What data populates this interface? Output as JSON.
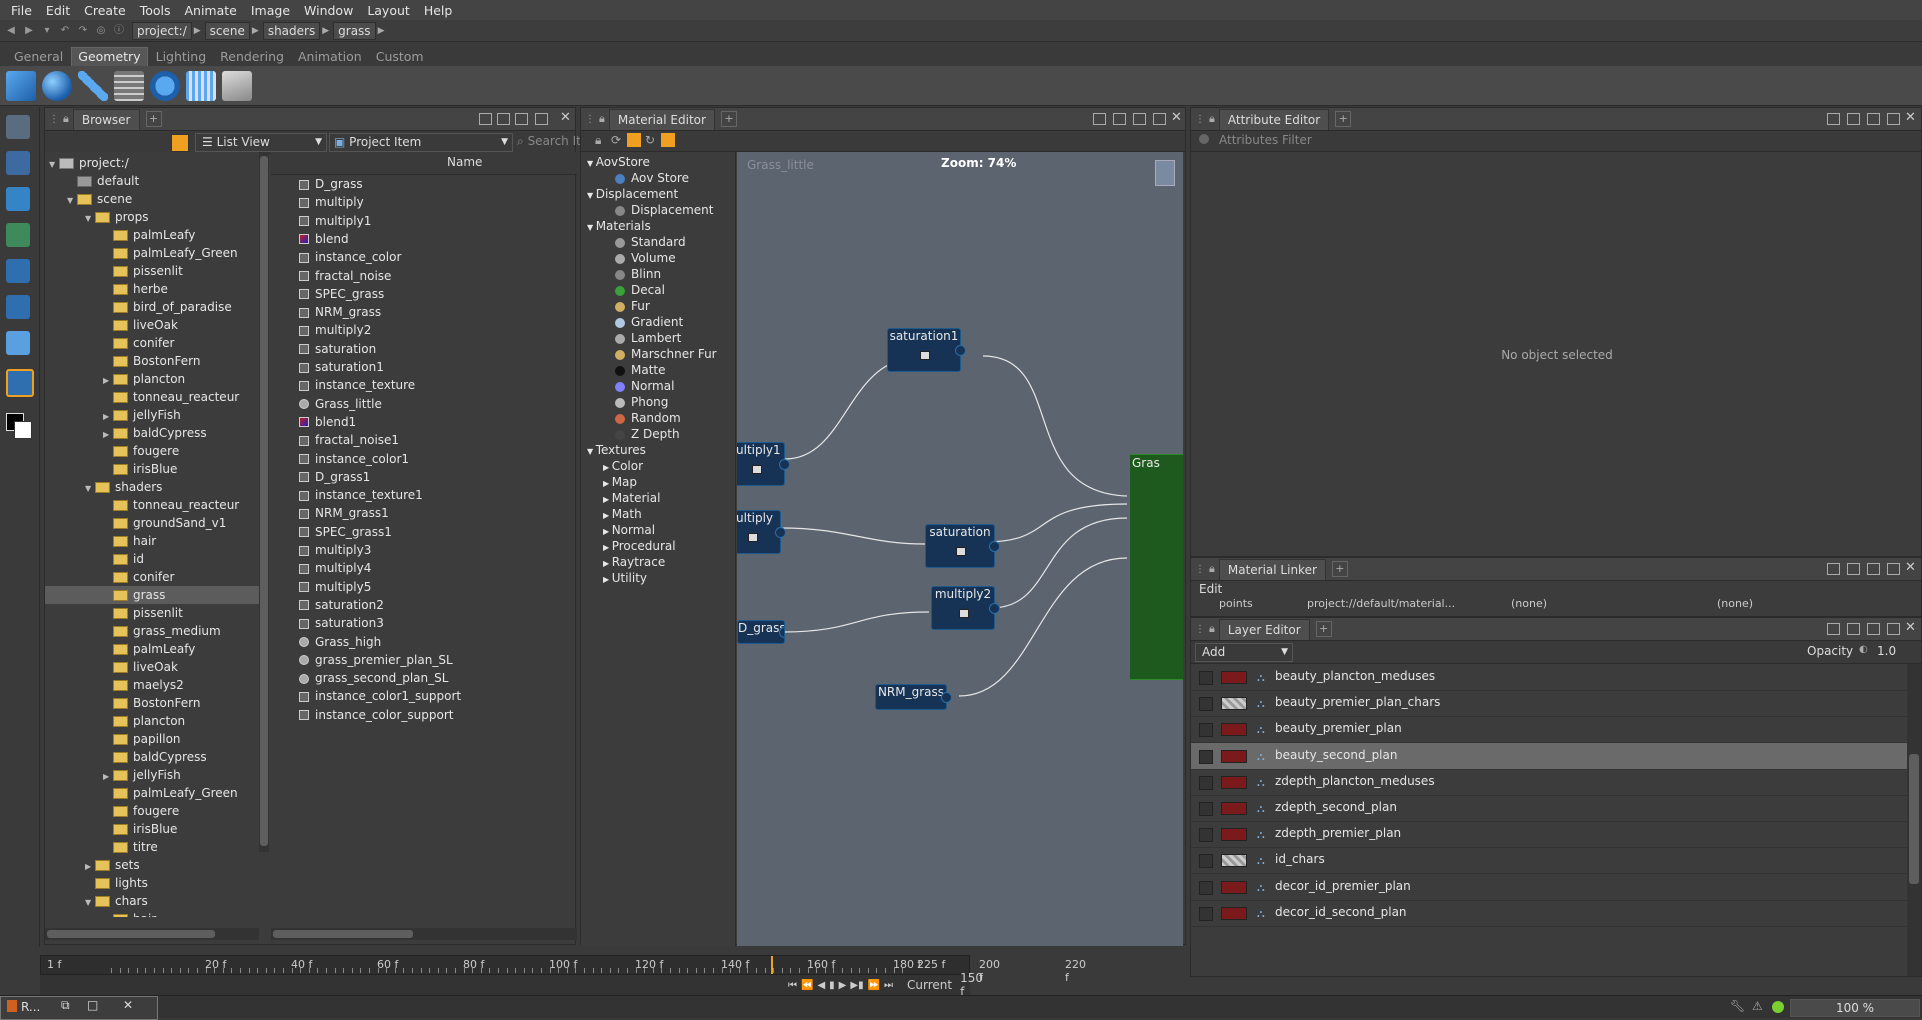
{
  "menu": [
    "File",
    "Edit",
    "Create",
    "Tools",
    "Animate",
    "Image",
    "Window",
    "Layout",
    "Help"
  ],
  "breadcrumbs": [
    "project:/",
    "scene",
    "shaders",
    "grass"
  ],
  "shelf_tabs": [
    {
      "label": "General",
      "active": false
    },
    {
      "label": "Geometry",
      "active": true
    },
    {
      "label": "Lighting",
      "active": false
    },
    {
      "label": "Rendering",
      "active": false
    },
    {
      "label": "Animation",
      "active": false
    },
    {
      "label": "Custom",
      "active": false
    }
  ],
  "shelf_icons": [
    "cube-icon",
    "sphere-icon",
    "cylinder-icon",
    "plane-icon",
    "disc-icon",
    "grid-icon",
    "scroll-icon"
  ],
  "browser": {
    "tab": "Browser",
    "view_mode": "List View",
    "filter": "Project Item",
    "search_placeholder": "Search Items",
    "column_name": "Name",
    "tree": [
      {
        "label": "project:/",
        "depth": 0,
        "expanded": true
      },
      {
        "label": "default",
        "depth": 1,
        "expanded": false
      },
      {
        "label": "scene",
        "depth": 1,
        "expanded": true
      },
      {
        "label": "props",
        "depth": 2,
        "expanded": true
      },
      {
        "label": "palmLeafy",
        "depth": 3
      },
      {
        "label": "palmLeafy_Green",
        "depth": 3
      },
      {
        "label": "pissenlit",
        "depth": 3
      },
      {
        "label": "herbe",
        "depth": 3
      },
      {
        "label": "bird_of_paradise",
        "depth": 3
      },
      {
        "label": "liveOak",
        "depth": 3
      },
      {
        "label": "conifer",
        "depth": 3
      },
      {
        "label": "BostonFern",
        "depth": 3
      },
      {
        "label": "plancton",
        "depth": 3,
        "collapsed": true
      },
      {
        "label": "tonneau_reacteur",
        "depth": 3
      },
      {
        "label": "jellyFish",
        "depth": 3,
        "collapsed": true
      },
      {
        "label": "baldCypress",
        "depth": 3,
        "collapsed": true
      },
      {
        "label": "fougere",
        "depth": 3
      },
      {
        "label": "irisBlue",
        "depth": 3
      },
      {
        "label": "shaders",
        "depth": 2,
        "expanded": true
      },
      {
        "label": "tonneau_reacteur",
        "depth": 3
      },
      {
        "label": "groundSand_v1",
        "depth": 3
      },
      {
        "label": "hair",
        "depth": 3
      },
      {
        "label": "id",
        "depth": 3
      },
      {
        "label": "conifer",
        "depth": 3
      },
      {
        "label": "grass",
        "depth": 3,
        "selected": true
      },
      {
        "label": "pissenlit",
        "depth": 3
      },
      {
        "label": "grass_medium",
        "depth": 3
      },
      {
        "label": "palmLeafy",
        "depth": 3
      },
      {
        "label": "liveOak",
        "depth": 3
      },
      {
        "label": "maelys2",
        "depth": 3
      },
      {
        "label": "BostonFern",
        "depth": 3
      },
      {
        "label": "plancton",
        "depth": 3
      },
      {
        "label": "papillon",
        "depth": 3
      },
      {
        "label": "baldCypress",
        "depth": 3
      },
      {
        "label": "jellyFish",
        "depth": 3,
        "collapsed": true
      },
      {
        "label": "palmLeafy_Green",
        "depth": 3
      },
      {
        "label": "fougere",
        "depth": 3
      },
      {
        "label": "irisBlue",
        "depth": 3
      },
      {
        "label": "titre",
        "depth": 3
      },
      {
        "label": "sets",
        "depth": 2,
        "collapsed": true
      },
      {
        "label": "lights",
        "depth": 2
      },
      {
        "label": "chars",
        "depth": 2,
        "expanded": true
      },
      {
        "label": "hair",
        "depth": 3
      }
    ],
    "items": [
      "D_grass",
      "multiply",
      "multiply1",
      "blend",
      "instance_color",
      "fractal_noise",
      "SPEC_grass",
      "NRM_grass",
      "multiply2",
      "saturation",
      "saturation1",
      "instance_texture",
      "Grass_little",
      "blend1",
      "fractal_noise1",
      "instance_color1",
      "D_grass1",
      "instance_texture1",
      "NRM_grass1",
      "SPEC_grass1",
      "multiply3",
      "multiply4",
      "multiply5",
      "saturation2",
      "saturation3",
      "Grass_high",
      "grass_premier_plan_SL",
      "grass_second_plan_SL",
      "instance_color1_support",
      "instance_color_support"
    ]
  },
  "material_editor": {
    "tab": "Material Editor",
    "graph_title": "Grass_little",
    "zoom": "Zoom: 74%",
    "library": [
      {
        "label": "AovStore",
        "type": "group"
      },
      {
        "label": "Aov Store",
        "type": "item",
        "color": "#4a7fc0"
      },
      {
        "label": "Displacement",
        "type": "group"
      },
      {
        "label": "Displacement",
        "type": "item",
        "color": "#888888"
      },
      {
        "label": "Materials",
        "type": "group"
      },
      {
        "label": "Standard",
        "type": "item",
        "color": "#999999"
      },
      {
        "label": "Volume",
        "type": "item",
        "color": "#aaaaaa"
      },
      {
        "label": "Blinn",
        "type": "item",
        "color": "#888888"
      },
      {
        "label": "Decal",
        "type": "item",
        "color": "#3aa03a"
      },
      {
        "label": "Fur",
        "type": "item",
        "color": "#d0b060"
      },
      {
        "label": "Gradient",
        "type": "item",
        "color": "#b0c8e0"
      },
      {
        "label": "Lambert",
        "type": "item",
        "color": "#aaaaaa"
      },
      {
        "label": "Marschner Fur",
        "type": "item",
        "color": "#d0b060"
      },
      {
        "label": "Matte",
        "type": "item",
        "color": "#111111"
      },
      {
        "label": "Normal",
        "type": "item",
        "color": "#8080ff"
      },
      {
        "label": "Phong",
        "type": "item",
        "color": "#bbbbbb"
      },
      {
        "label": "Random",
        "type": "item",
        "color": "#cc6644"
      },
      {
        "label": "Z Depth",
        "type": "item",
        "color": "#444444"
      },
      {
        "label": "Textures",
        "type": "group"
      },
      {
        "label": "Color",
        "type": "sub"
      },
      {
        "label": "Map",
        "type": "sub"
      },
      {
        "label": "Material",
        "type": "sub"
      },
      {
        "label": "Math",
        "type": "sub"
      },
      {
        "label": "Normal",
        "type": "sub"
      },
      {
        "label": "Procedural",
        "type": "sub"
      },
      {
        "label": "Raytrace",
        "type": "sub"
      },
      {
        "label": "Utility",
        "type": "sub"
      }
    ],
    "nodes": [
      {
        "id": "saturation1",
        "label": "saturation1"
      },
      {
        "id": "multiply1",
        "label": "ultiply1"
      },
      {
        "id": "multiply",
        "label": "ultiply"
      },
      {
        "id": "saturation",
        "label": "saturation"
      },
      {
        "id": "multiply2",
        "label": "multiply2"
      },
      {
        "id": "dgrass",
        "label": "D_grass"
      },
      {
        "id": "nrm",
        "label": "NRM_grass"
      },
      {
        "id": "out",
        "label": "Gras"
      }
    ]
  },
  "attribute_editor": {
    "tab": "Attribute Editor",
    "filter_placeholder": "Attributes Filter",
    "empty": "No object selected"
  },
  "material_linker": {
    "tab": "Material Linker",
    "menu": "Edit",
    "col1": "points",
    "col2": "project://default/material...",
    "col3": "(none)",
    "col4": "(none)"
  },
  "layer_editor": {
    "tab": "Layer Editor",
    "add": "Add",
    "opacity_label": "Opacity",
    "opacity_value": "1.0",
    "layers": [
      {
        "name": "beauty_plancton_meduses",
        "thumb": "red"
      },
      {
        "name": "beauty_premier_plan_chars",
        "thumb": "check"
      },
      {
        "name": "beauty_premier_plan",
        "thumb": "red"
      },
      {
        "name": "beauty_second_plan",
        "thumb": "red",
        "selected": true
      },
      {
        "name": "zdepth_plancton_meduses",
        "thumb": "red"
      },
      {
        "name": "zdepth_second_plan",
        "thumb": "red"
      },
      {
        "name": "zdepth_premier_plan",
        "thumb": "red"
      },
      {
        "name": "id_chars",
        "thumb": "check"
      },
      {
        "name": "decor_id_premier_plan",
        "thumb": "red"
      },
      {
        "name": "decor_id_second_plan",
        "thumb": "red"
      }
    ]
  },
  "timeline": {
    "start": "1 f",
    "ticks": [
      "20 f",
      "40 f",
      "60 f",
      "80 f",
      "100 f",
      "120 f",
      "140 f",
      "160 f",
      "180 f",
      "200 f",
      "220 f"
    ],
    "end": "225 f",
    "current_label": "Current",
    "current": "150 f"
  },
  "statusbar": {
    "app_tab": "R...",
    "zoom": "100 %"
  }
}
